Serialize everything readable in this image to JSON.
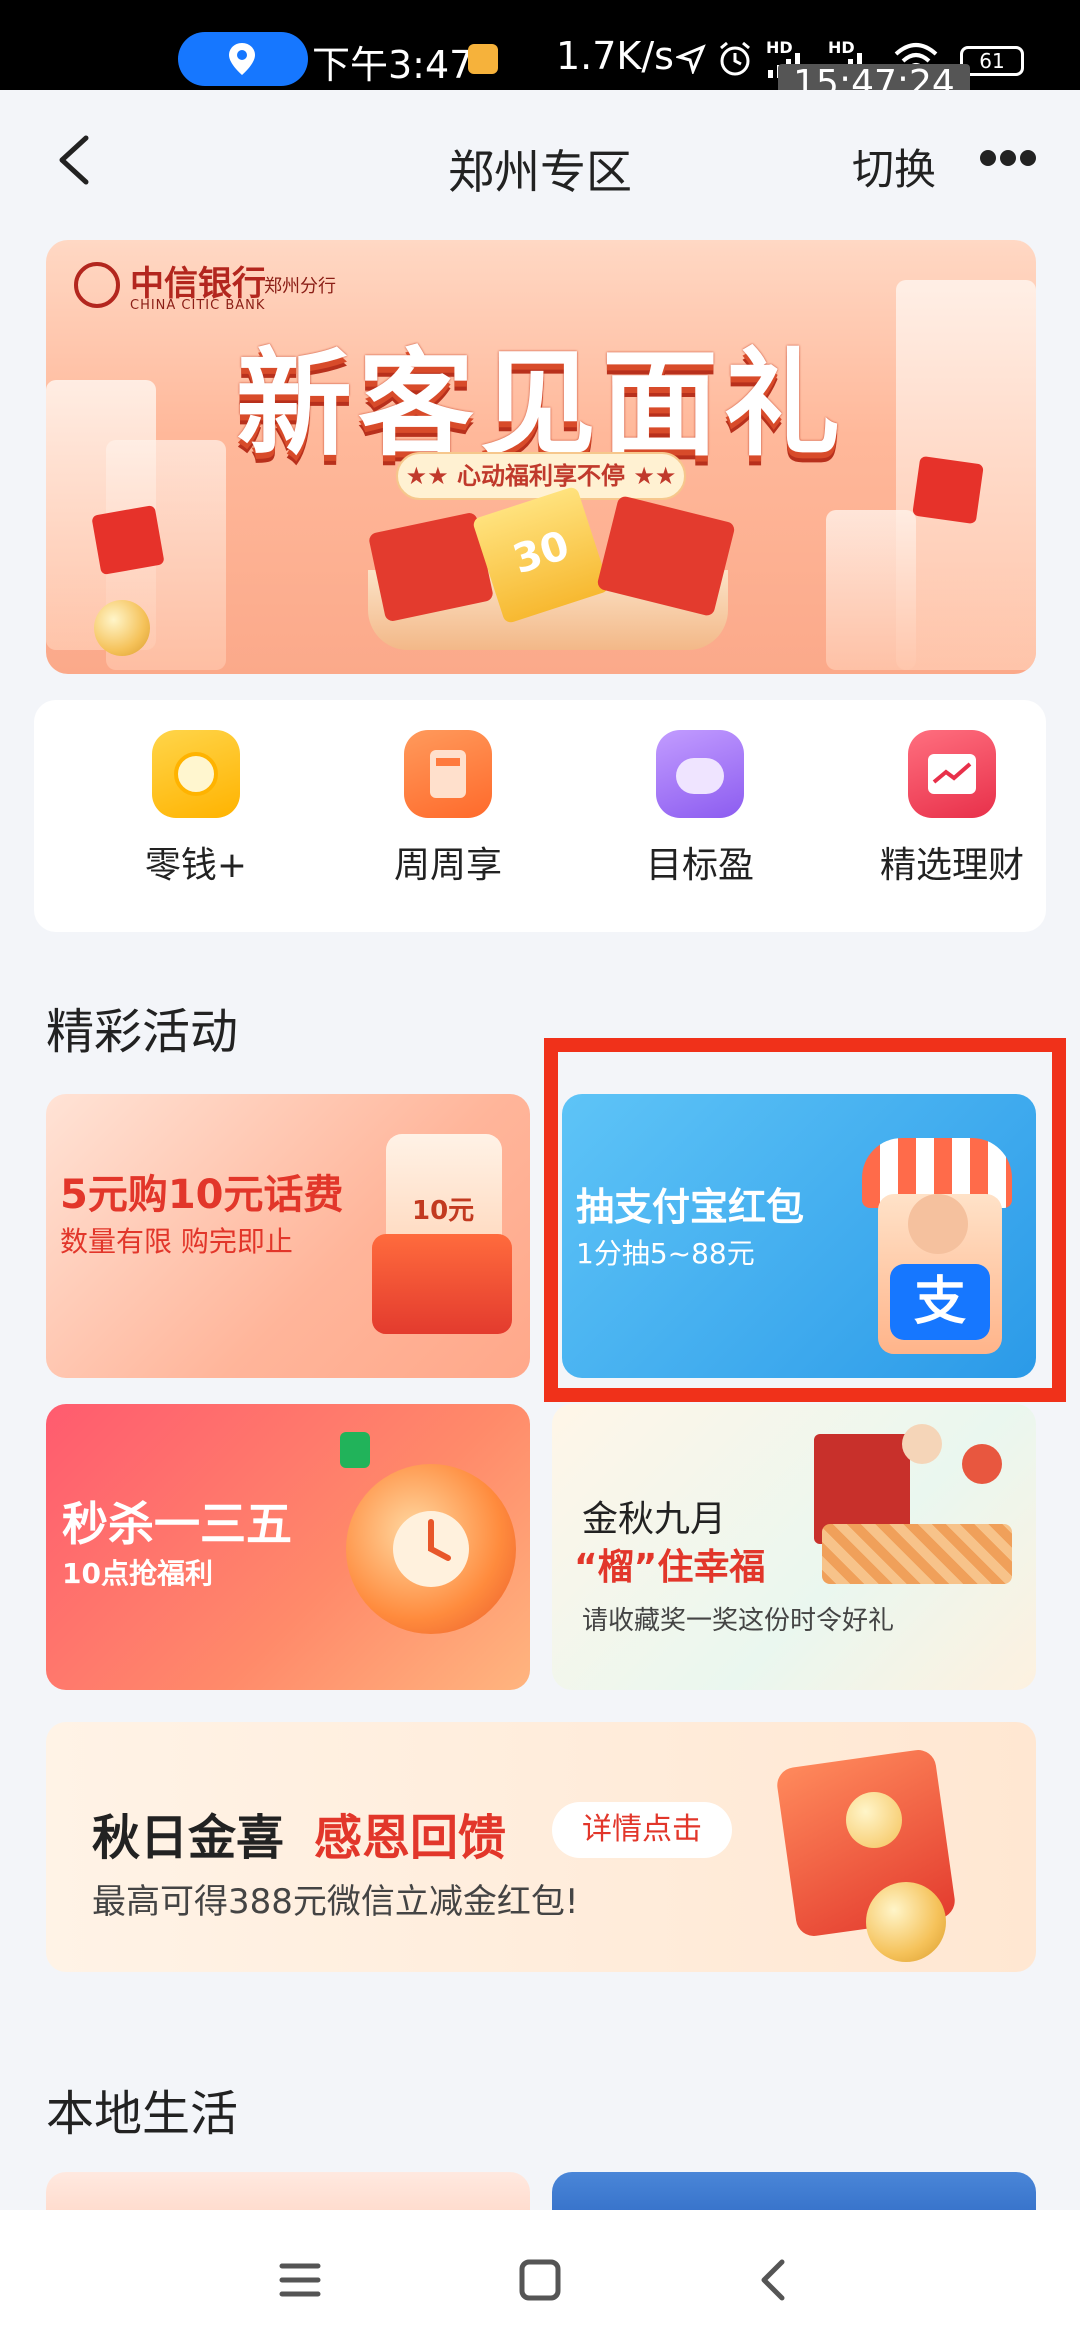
{
  "status_bar": {
    "time": "下午3:47",
    "net_speed": "1.7K/s",
    "clock_overlay": "15:47:24",
    "hd1": "HD",
    "hd2": "HD",
    "battery": "61"
  },
  "header": {
    "title": "郑州专区",
    "switch_label": "切换"
  },
  "hero_banner": {
    "bank_name": "中信银行",
    "bank_name_en": "CHINA CITIC BANK",
    "branch": "郑州分行",
    "title": "新客见面礼",
    "subtitle": "★★ 心动福利享不停 ★★",
    "coupon_value": "30"
  },
  "quick_menu": [
    {
      "label": "零钱+",
      "icon": "coin-icon",
      "color": "#ffc21a"
    },
    {
      "label": "周周享",
      "icon": "calculator-icon",
      "color": "#ff7a3d"
    },
    {
      "label": "目标盈",
      "icon": "piggy-bank-icon",
      "color": "#a77cf2"
    },
    {
      "label": "精选理财",
      "icon": "chart-icon",
      "color": "#f2475b"
    }
  ],
  "activities": {
    "section_title": "精彩活动",
    "cards": [
      {
        "title": "5元购10元话费",
        "subtitle": "数量有限 购完即止",
        "tag": "10元"
      },
      {
        "title": "抽支付宝红包",
        "subtitle": "1分抽5~88元",
        "logo": "支"
      },
      {
        "title": "秒杀一三五",
        "subtitle": "10点抢福利"
      },
      {
        "title": "金秋九月",
        "title2": "“榴”住幸福",
        "subtitle": "请收藏奖一奖这份时令好礼"
      }
    ],
    "wide_card": {
      "title_a": "秋日金喜",
      "title_b": "感恩回馈",
      "button": "详情点击",
      "subtitle": "最高可得388元微信立减金红包!"
    }
  },
  "local_life": {
    "section_title": "本地生活"
  },
  "nav_bar": {
    "menu_icon": "menu-icon",
    "home_icon": "home-icon",
    "back_icon": "back-icon"
  }
}
